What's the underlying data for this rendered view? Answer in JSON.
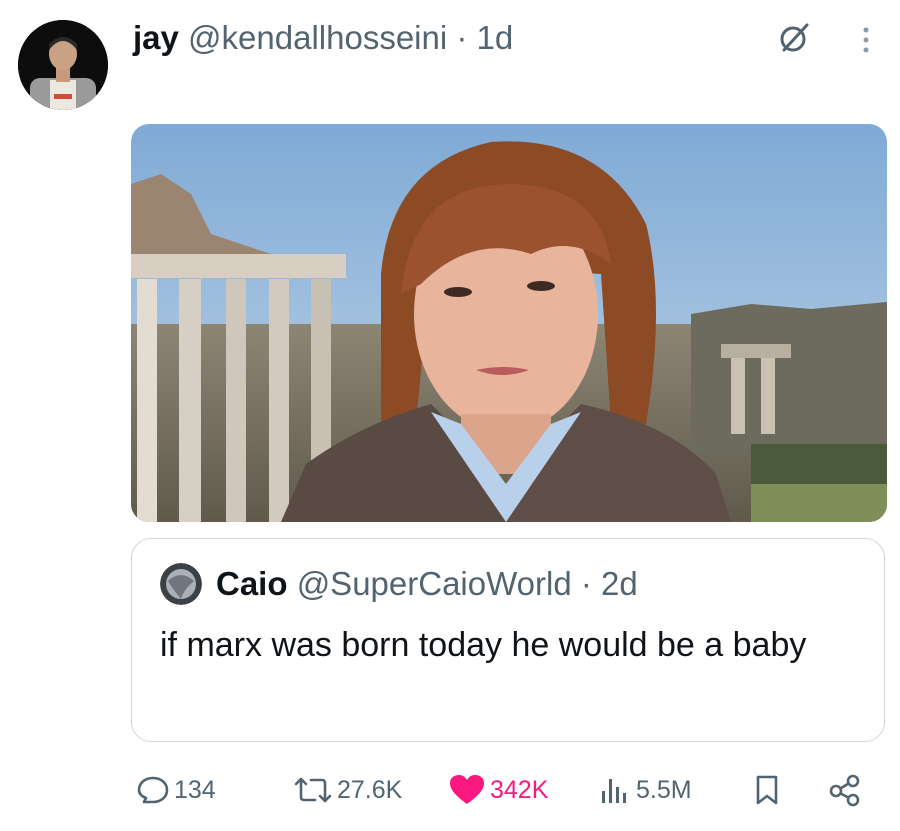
{
  "post": {
    "author_name": "jay",
    "author_handle": "@kendallhosseini",
    "separator": "·",
    "age": "1d"
  },
  "quoted": {
    "author_name": "Caio",
    "author_handle": "@SuperCaioWorld",
    "separator": "·",
    "age": "2d",
    "text": "if marx was born today he would be a baby"
  },
  "actions": {
    "replies": "134",
    "reposts": "27.6K",
    "likes": "342K",
    "views": "5.5M"
  },
  "icons": {
    "reply": "reply-icon",
    "repost": "repost-icon",
    "like": "heart-icon",
    "views": "views-icon",
    "bookmark": "bookmark-icon",
    "share": "share-icon",
    "grok": "grok-icon",
    "more": "more-icon"
  },
  "colors": {
    "text": "#0f1419",
    "secondary": "#536471",
    "like": "#f91880",
    "border": "#cfd9de"
  }
}
